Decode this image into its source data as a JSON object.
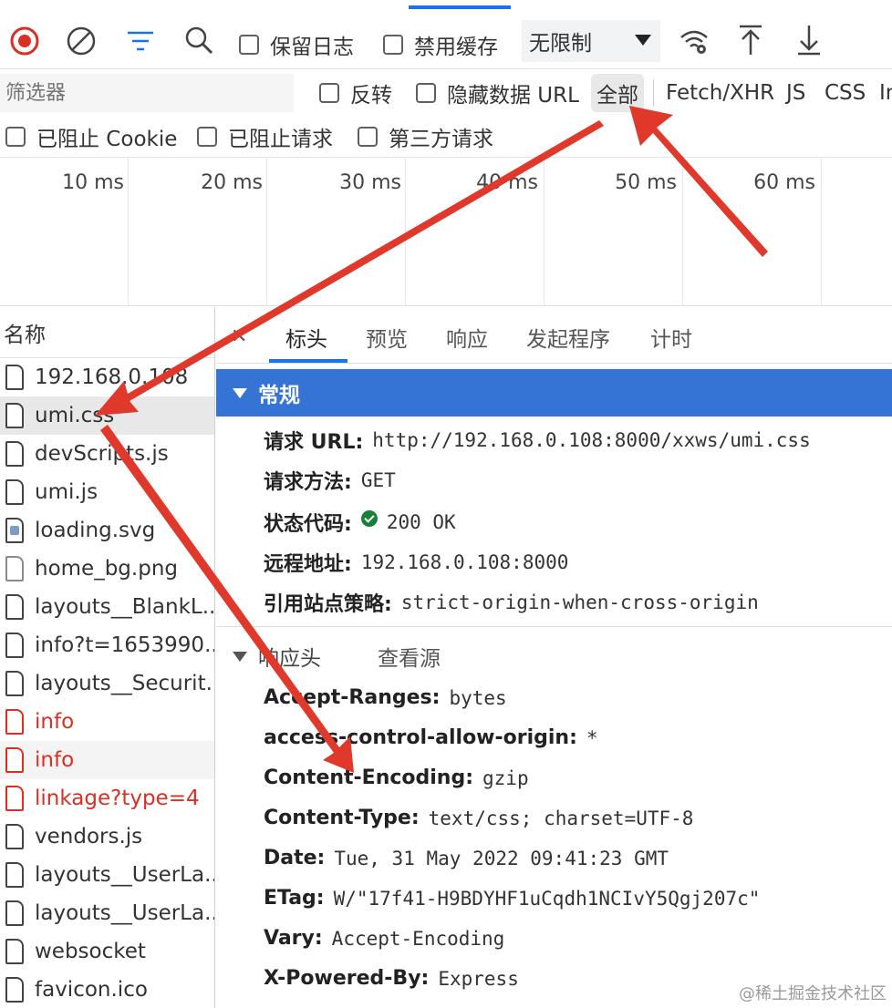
{
  "toolbar": {
    "preserve_log": "保留日志",
    "disable_cache": "禁用缓存",
    "throttling": "无限制"
  },
  "filter": {
    "placeholder": "筛选器",
    "invert": "反转",
    "hide_data_urls": "隐藏数据 URL",
    "types": [
      "全部",
      "Fetch/XHR",
      "JS",
      "CSS",
      "In"
    ]
  },
  "options": {
    "blocked_cookies": "已阻止 Cookie",
    "blocked_requests": "已阻止请求",
    "third_party": "第三方请求"
  },
  "overview": {
    "ticks": [
      "10 ms",
      "20 ms",
      "30 ms",
      "40 ms",
      "50 ms",
      "60 ms"
    ]
  },
  "requests": {
    "header": "名称",
    "items": [
      {
        "name": "192.168.0.108",
        "icon": "document-icon",
        "status": "normal"
      },
      {
        "name": "umi.css",
        "icon": "document-icon",
        "status": "selected"
      },
      {
        "name": "devScripts.js",
        "icon": "document-icon",
        "status": "normal"
      },
      {
        "name": "umi.js",
        "icon": "document-icon",
        "status": "normal"
      },
      {
        "name": "loading.svg",
        "icon": "svg-image-icon",
        "status": "normal"
      },
      {
        "name": "home_bg.png",
        "icon": "image-icon",
        "status": "normal"
      },
      {
        "name": "layouts__BlankL...",
        "icon": "document-icon",
        "status": "normal"
      },
      {
        "name": "info?t=1653990...",
        "icon": "document-icon",
        "status": "normal"
      },
      {
        "name": "layouts__Securit...",
        "icon": "document-icon",
        "status": "normal"
      },
      {
        "name": "info",
        "icon": "document-icon",
        "status": "error"
      },
      {
        "name": "info",
        "icon": "document-icon",
        "status": "error"
      },
      {
        "name": "linkage?type=4",
        "icon": "document-icon",
        "status": "error"
      },
      {
        "name": "vendors.js",
        "icon": "document-icon",
        "status": "normal"
      },
      {
        "name": "layouts__UserLa...",
        "icon": "document-icon",
        "status": "normal"
      },
      {
        "name": "layouts__UserLa...",
        "icon": "document-icon",
        "status": "normal"
      },
      {
        "name": "websocket",
        "icon": "document-icon",
        "status": "normal"
      },
      {
        "name": "favicon.ico",
        "icon": "document-icon",
        "status": "normal"
      }
    ]
  },
  "detail_tabs": [
    "标头",
    "预览",
    "响应",
    "发起程序",
    "计时"
  ],
  "general": {
    "title": "常规",
    "request_url_label": "请求 URL:",
    "request_url": "http://192.168.0.108:8000/xxws/umi.css",
    "method_label": "请求方法:",
    "method": "GET",
    "status_label": "状态代码:",
    "status": "200 OK",
    "remote_label": "远程地址:",
    "remote": "192.168.0.108:8000",
    "policy_label": "引用站点策略:",
    "policy": "strict-origin-when-cross-origin"
  },
  "response_headers": {
    "title": "响应头",
    "view_source": "查看源",
    "items": [
      {
        "key": "Accept-Ranges:",
        "value": "bytes"
      },
      {
        "key": "access-control-allow-origin:",
        "value": "*"
      },
      {
        "key": "Content-Encoding:",
        "value": "gzip"
      },
      {
        "key": "Content-Type:",
        "value": "text/css; charset=UTF-8"
      },
      {
        "key": "Date:",
        "value": "Tue, 31 May 2022 09:41:23 GMT"
      },
      {
        "key": "ETag:",
        "value": "W/\"17f41-H9BDYHF1uCqdh1NCIvY5Qgj207c\""
      },
      {
        "key": "Vary:",
        "value": "Accept-Encoding"
      },
      {
        "key": "X-Powered-By:",
        "value": "Express"
      }
    ]
  },
  "watermark": "@稀土掘金技术社区",
  "colors": {
    "record_red": "#d93025",
    "accent_blue": "#1a73e8",
    "general_header_bg": "#3574d4",
    "annotation_arrow": "#e0392b",
    "status_ok_green": "#188038"
  }
}
